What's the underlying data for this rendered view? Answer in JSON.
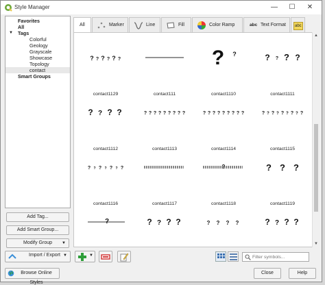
{
  "window": {
    "title": "Style Manager",
    "controls": {
      "minimize": "—",
      "maximize": "☐",
      "close": "✕"
    }
  },
  "tree": {
    "favorites": "Favorites",
    "all": "All",
    "tags": "Tags",
    "tag_items": [
      "Colorful",
      "Geology",
      "Grayscale",
      "Showcase",
      "Topology",
      "contact"
    ],
    "selected": "contact",
    "smart_groups": "Smart Groups"
  },
  "left_buttons": {
    "add_tag": "Add Tag...",
    "add_smart_group": "Add Smart Group...",
    "modify_group": "Modify Group",
    "import_export": "Import / Export"
  },
  "tabs": [
    {
      "label": "All",
      "icon": "none",
      "active": true
    },
    {
      "label": "Marker",
      "icon": "marker-icon"
    },
    {
      "label": "Line",
      "icon": "line-icon"
    },
    {
      "label": "Fill",
      "icon": "fill-icon"
    },
    {
      "label": "Color Ramp",
      "icon": "color-ramp-icon"
    },
    {
      "label": "Text Format",
      "icon": "text-format-icon"
    },
    {
      "label": "abc",
      "icon": "label-settings-icon"
    }
  ],
  "symbols": [
    {
      "label": "contact1129",
      "preview": "line-q"
    },
    {
      "label": "contact111",
      "preview": "line-solid"
    },
    {
      "label": "contact1110",
      "preview": "big-q"
    },
    {
      "label": "contact1111",
      "preview": "q-spaced"
    },
    {
      "label": "contact1112",
      "preview": "q-row"
    },
    {
      "label": "contact1113",
      "preview": "q-dense"
    },
    {
      "label": "contact1114",
      "preview": "q-dense"
    },
    {
      "label": "contact1115",
      "preview": "q-dots"
    },
    {
      "label": "contact1116",
      "preview": "q-dash"
    },
    {
      "label": "contact1117",
      "preview": "thick-dash"
    },
    {
      "label": "contact1118",
      "preview": "thick-dash-q"
    },
    {
      "label": "contact1119",
      "preview": "q-wide"
    },
    {
      "label": "",
      "preview": "line-q-mark"
    },
    {
      "label": "",
      "preview": "q-row"
    },
    {
      "label": "",
      "preview": "q-spaced-small"
    },
    {
      "label": "",
      "preview": "q-row"
    }
  ],
  "toolbar": {
    "add": "add-symbol-icon",
    "remove": "remove-symbol-icon",
    "edit": "edit-symbol-icon",
    "filter_placeholder": "Filter symbols..."
  },
  "bottom": {
    "browse": "Browse Online Styles",
    "close": "Close",
    "help": "Help"
  },
  "colors": {
    "accent": "#3a8fd8",
    "add_green": "#2e9e3a",
    "remove_red": "#d33b3b",
    "edit_yellow": "#e8c64a"
  }
}
